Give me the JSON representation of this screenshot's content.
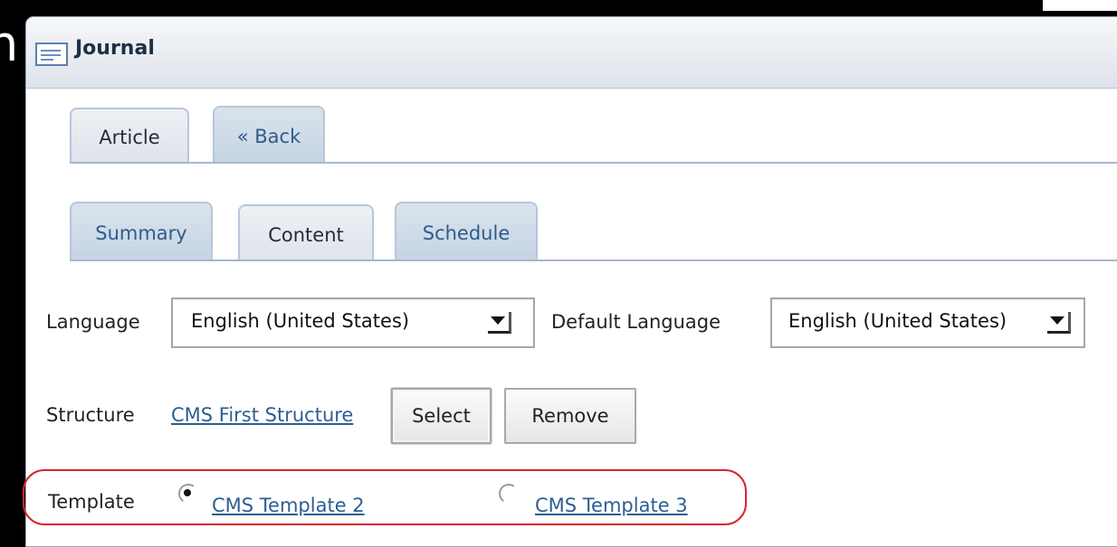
{
  "window": {
    "title": "Journal"
  },
  "edge_fragment": "n",
  "tabs_primary": [
    {
      "label": "Article",
      "active": true
    },
    {
      "label": "« Back",
      "active": false
    }
  ],
  "tabs_secondary": [
    {
      "label": "Summary",
      "active": false
    },
    {
      "label": "Content",
      "active": true
    },
    {
      "label": "Schedule",
      "active": false
    }
  ],
  "form": {
    "language_label": "Language",
    "language_value": "English (United States)",
    "default_language_label": "Default Language",
    "default_language_value": "English (United States)",
    "structure_label": "Structure",
    "structure_link": "CMS First Structure",
    "select_button": "Select",
    "remove_button": "Remove",
    "template_label": "Template",
    "template_options": [
      {
        "label": "CMS Template 2",
        "selected": true
      },
      {
        "label": "CMS Template 3",
        "selected": false
      }
    ]
  },
  "colors": {
    "highlight": "#d4262c",
    "link": "#2d5e93"
  },
  "icons": {
    "portlet": "journal-portlet-icon"
  }
}
